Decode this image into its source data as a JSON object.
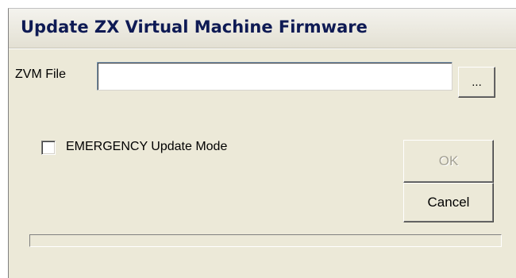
{
  "window": {
    "title": "Update ZX Virtual Machine Firmware"
  },
  "form": {
    "zvm_file_label": "ZVM File",
    "zvm_file_value": "",
    "browse_label": "...",
    "emergency_label": "EMERGENCY Update Mode",
    "emergency_checked": false
  },
  "buttons": {
    "ok_label": "OK",
    "ok_enabled": false,
    "cancel_label": "Cancel"
  },
  "progress": {
    "value": 0
  },
  "colors": {
    "window_bg": "#ece9d8",
    "title_text": "#0e1a54",
    "disabled_text": "#a3a093"
  }
}
